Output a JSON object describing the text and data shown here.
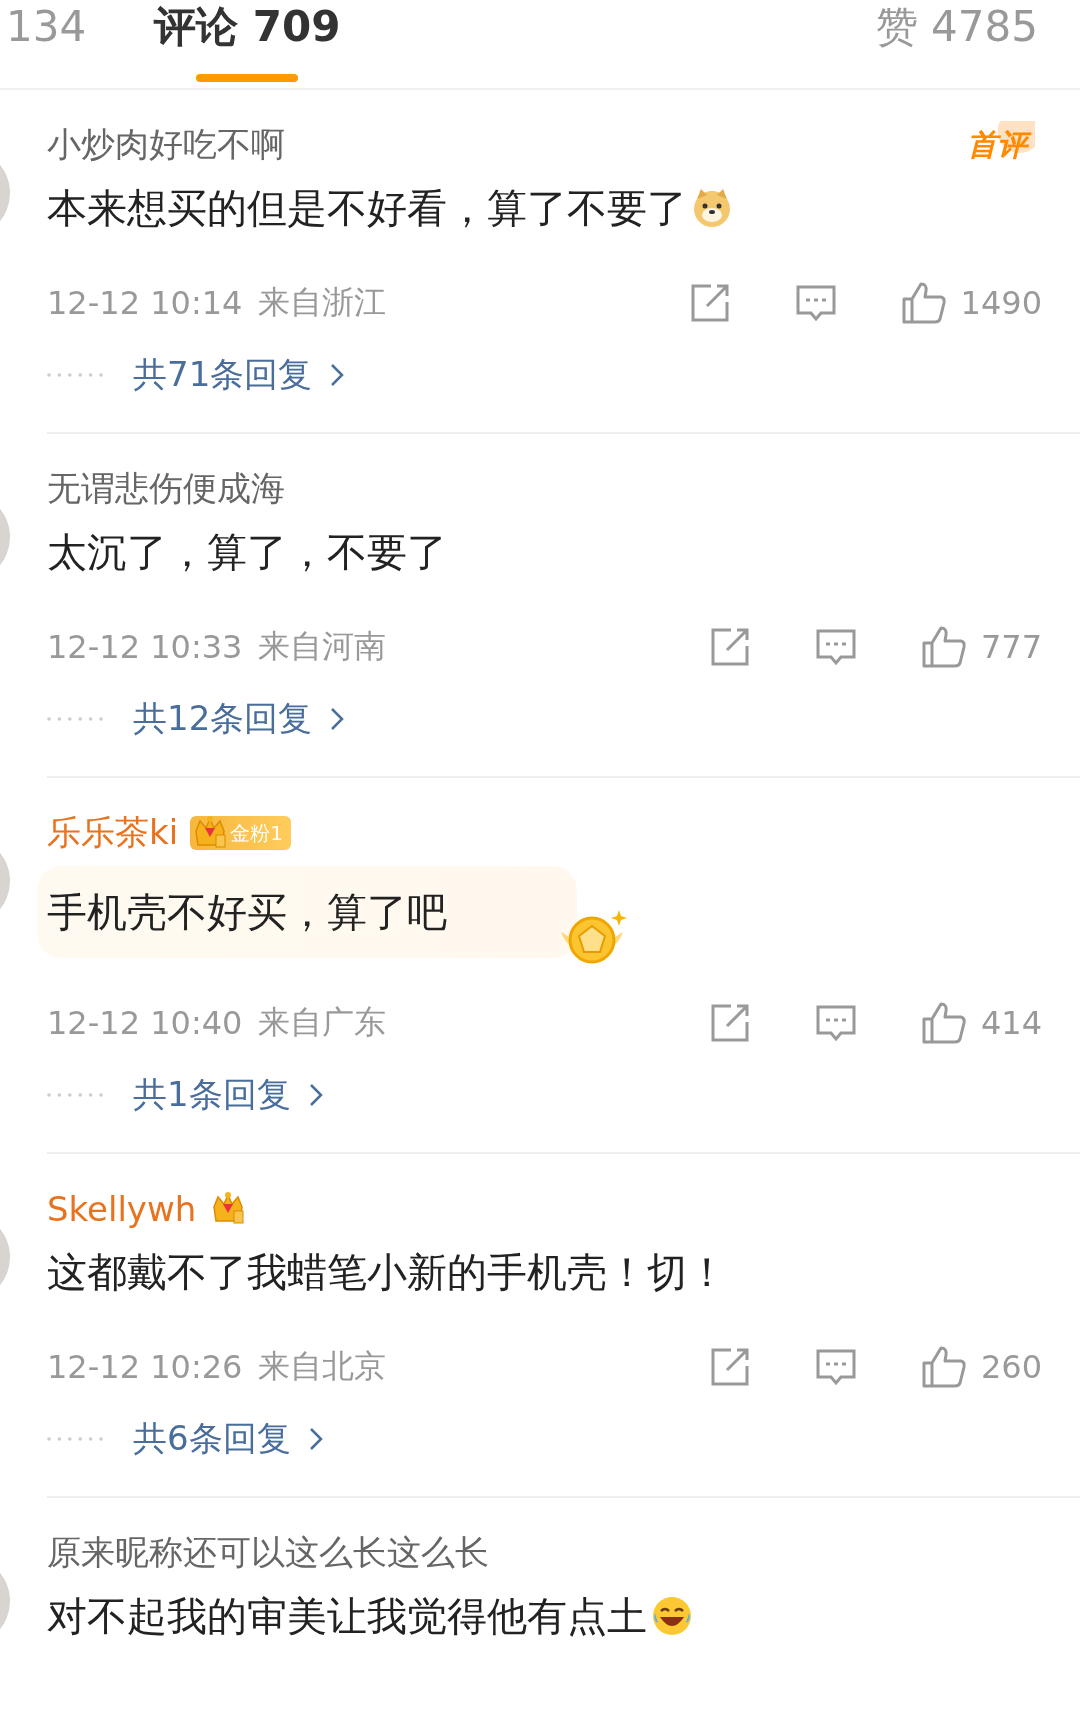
{
  "tabs": [
    {
      "label": "134",
      "selected": false
    },
    {
      "label": "评论 709",
      "selected": true
    }
  ],
  "likes_tab": {
    "label": "赞 4785"
  },
  "comments": [
    {
      "name": "小炒肉好吃不啊",
      "member": false,
      "tag": "首评",
      "text": "本来想买的但是不好看，算了不要了",
      "emoji": {
        "kind": "doge"
      },
      "highlighted": false,
      "time": "12-12 10:14",
      "location": "来自浙江",
      "likes": "1490",
      "replies": "共71条回复"
    },
    {
      "name": "无谓悲伤便成海",
      "member": false,
      "text": "太沉了，算了，不要了",
      "highlighted": false,
      "time": "12-12 10:33",
      "location": "来自河南",
      "likes": "777",
      "replies": "共12条回复"
    },
    {
      "name": "乐乐茶ki",
      "member": true,
      "badge": {
        "kind": "fan",
        "text": "金粉1"
      },
      "text": "手机壳不好买，算了吧",
      "highlighted": true,
      "time": "12-12 10:40",
      "location": "来自广东",
      "likes": "414",
      "replies": "共1条回复"
    },
    {
      "name": "Skellywh",
      "member": true,
      "badge": {
        "kind": "crown"
      },
      "text": "这都戴不了我蜡笔小新的手机壳！切！",
      "highlighted": false,
      "time": "12-12 10:26",
      "location": "来自北京",
      "likes": "260",
      "replies": "共6条回复"
    },
    {
      "name": "原来昵称还可以这么长这么长",
      "member": false,
      "text": "对不起我的审美让我觉得他有点土",
      "emoji": {
        "kind": "laugh"
      },
      "highlighted": false
    }
  ]
}
